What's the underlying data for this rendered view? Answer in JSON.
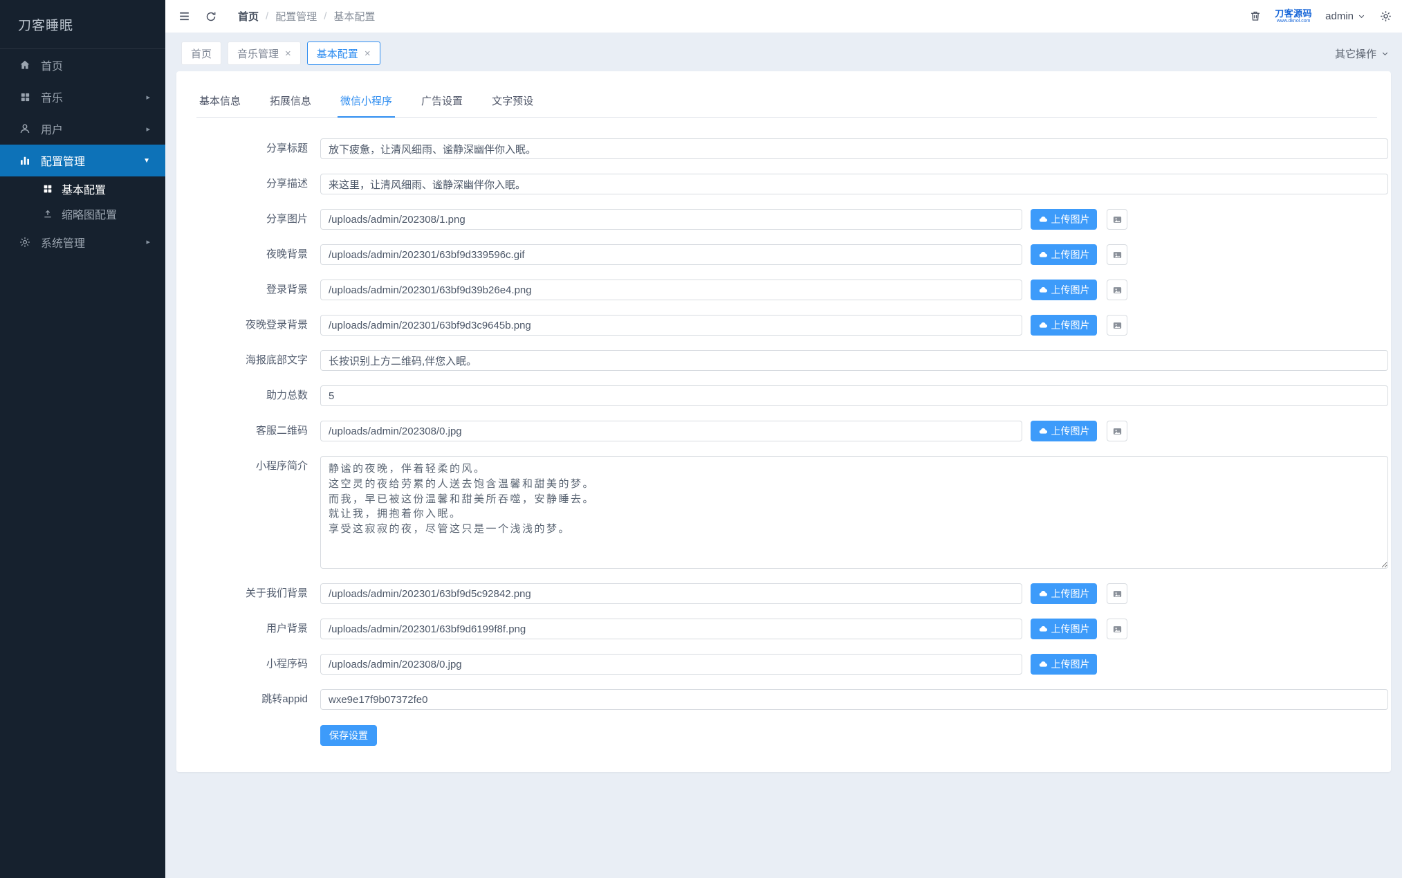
{
  "colors": {
    "primary": "#2d8cf0",
    "button_blue": "#3d9bfa",
    "sidebar_active": "#0d72b8",
    "sidebar_bg": "#16212e"
  },
  "icons": {
    "close": "×",
    "caret_down": "▼",
    "arrow_right": "▸",
    "separator": "/"
  },
  "sidebar": {
    "title": "刀客睡眠",
    "items": [
      {
        "label": "首页",
        "icon": "home"
      },
      {
        "label": "音乐",
        "icon": "grid"
      },
      {
        "label": "用户",
        "icon": "user"
      },
      {
        "label": "配置管理",
        "icon": "chart"
      },
      {
        "label": "系统管理",
        "icon": "gear"
      }
    ],
    "subitems": [
      {
        "label": "基本配置",
        "icon": "grid"
      },
      {
        "label": "缩略图配置",
        "icon": "upload"
      }
    ]
  },
  "header": {
    "breadcrumb": [
      "首页",
      "配置管理",
      "基本配置"
    ],
    "logo_text": "刀客源码",
    "logo_subtext": "www.dknol.com",
    "username": "admin"
  },
  "tags": {
    "chips": [
      {
        "label": "首页"
      },
      {
        "label": "音乐管理"
      },
      {
        "label": "基本配置"
      }
    ],
    "other_actions": "其它操作"
  },
  "form": {
    "tabs": [
      {
        "label": "基本信息"
      },
      {
        "label": "拓展信息"
      },
      {
        "label": "微信小程序"
      },
      {
        "label": "广告设置"
      },
      {
        "label": "文字预设"
      }
    ],
    "upload_label": "上传图片",
    "save_label": "保存设置",
    "rows": [
      {
        "label": "分享标题",
        "value": "放下疲惫，让清风细雨、谧静深幽伴你入眠。"
      },
      {
        "label": "分享描述",
        "value": "来这里，让清风细雨、谧静深幽伴你入眠。"
      },
      {
        "label": "分享图片",
        "value": "/uploads/admin/202308/1.png"
      },
      {
        "label": "夜晚背景",
        "value": "/uploads/admin/202301/63bf9d339596c.gif"
      },
      {
        "label": "登录背景",
        "value": "/uploads/admin/202301/63bf9d39b26e4.png"
      },
      {
        "label": "夜晚登录背景",
        "value": "/uploads/admin/202301/63bf9d3c9645b.png"
      },
      {
        "label": "海报底部文字",
        "value": "长按识别上方二维码,伴您入眠。"
      },
      {
        "label": "助力总数",
        "value": "5"
      },
      {
        "label": "客服二维码",
        "value": "/uploads/admin/202308/0.jpg"
      },
      {
        "label": "小程序简介",
        "value": "静谧的夜晚，伴着轻柔的风。\n这空灵的夜给劳累的人送去饱含温馨和甜美的梦。\n而我，早已被这份温馨和甜美所吞噬，安静睡去。\n就让我，拥抱着你入眠。\n享受这寂寂的夜，尽管这只是一个浅浅的梦。"
      },
      {
        "label": "关于我们背景",
        "value": "/uploads/admin/202301/63bf9d5c92842.png"
      },
      {
        "label": "用户背景",
        "value": "/uploads/admin/202301/63bf9d6199f8f.png"
      },
      {
        "label": "小程序码",
        "value": "/uploads/admin/202308/0.jpg"
      },
      {
        "label": "跳转appid",
        "value": "wxe9e17f9b07372fe0"
      }
    ]
  }
}
